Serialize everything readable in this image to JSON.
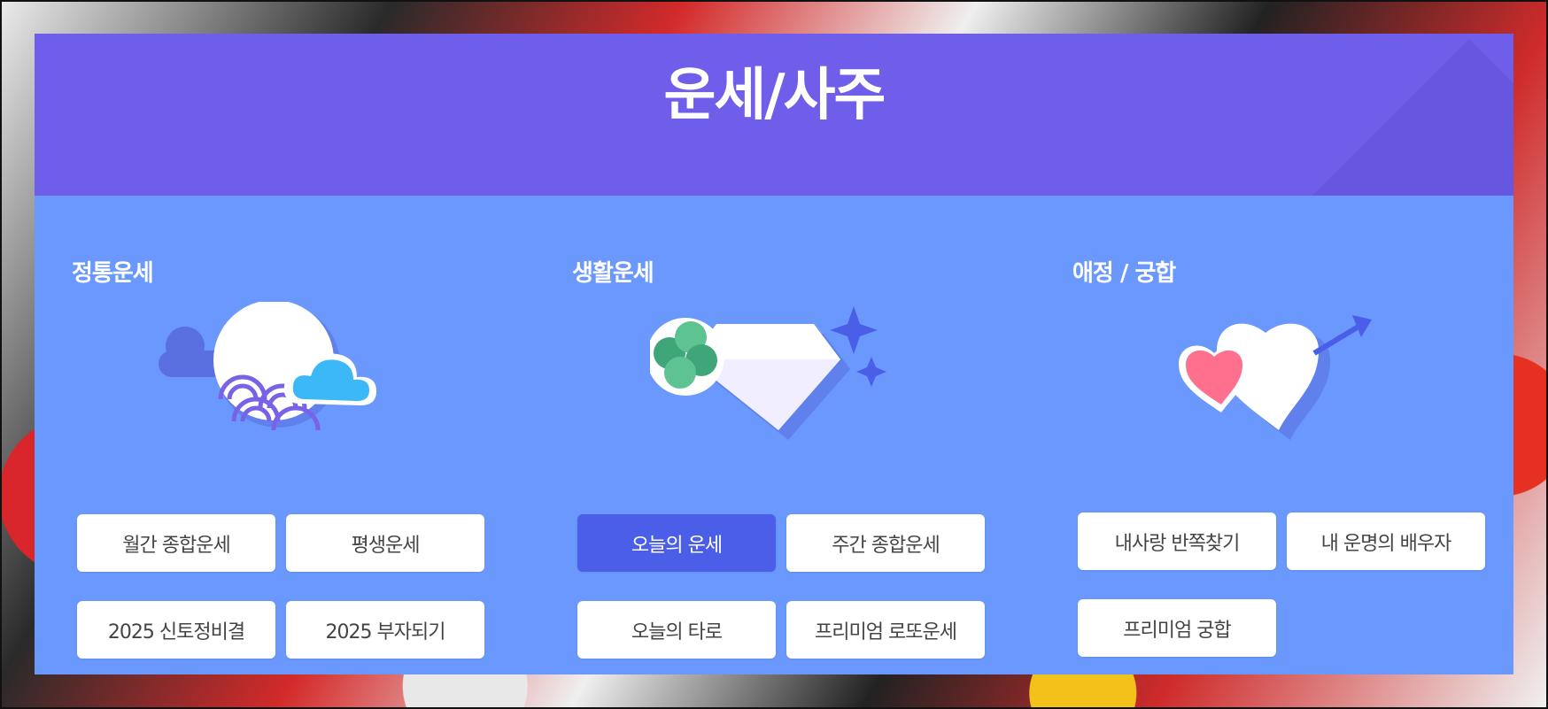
{
  "header": {
    "title": "운세/사주"
  },
  "columns": [
    {
      "title": "정통운세",
      "buttons": [
        {
          "label": "월간 종합운세"
        },
        {
          "label": "평생운세"
        },
        {
          "label": "2025 신토정비결"
        },
        {
          "label": "2025 부자되기"
        }
      ]
    },
    {
      "title": "생활운세",
      "buttons": [
        {
          "label": "오늘의 운세",
          "active": true
        },
        {
          "label": "주간 종합운세"
        },
        {
          "label": "오늘의 타로"
        },
        {
          "label": "프리미엄 로또운세"
        }
      ]
    },
    {
      "title": "애정 / 궁합",
      "buttons": [
        {
          "label": "내사랑 반쪽찾기"
        },
        {
          "label": "내 운명의 배우자"
        },
        {
          "label": "프리미엄 궁합"
        }
      ]
    }
  ],
  "illustrations": [
    "moon-cloud-icon",
    "clover-diamond-icon",
    "hearts-arrow-icon"
  ],
  "colors": {
    "header_bg": "#6e5ee9",
    "panel_bg": "#6a98fc",
    "button_active": "#4b5ee8",
    "button_bg": "#ffffff"
  }
}
